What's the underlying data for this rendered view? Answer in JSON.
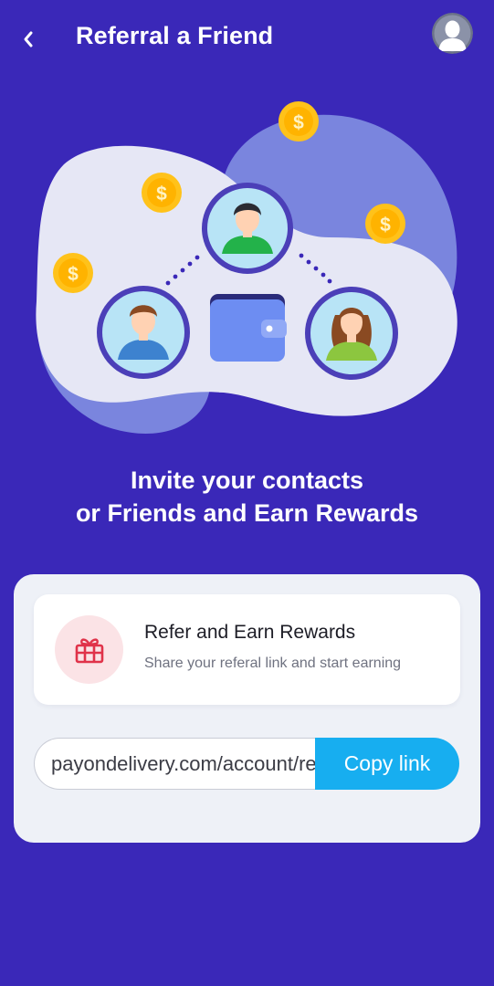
{
  "header": {
    "title": "Referral a Friend",
    "back_icon": "chevron-left-icon",
    "avatar_icon": "user-avatar-icon"
  },
  "hero": {
    "coin_symbol": "$",
    "colors": {
      "background": "#3a28b8",
      "blob_light": "#e6e7f5",
      "blob_accent": "#7a85de",
      "coin": "#ffc21a",
      "wallet": "#6d8df2"
    }
  },
  "headline": {
    "line1": "Invite your contacts",
    "line2": "or Friends and Earn Rewards"
  },
  "reward_card": {
    "icon": "gift-icon",
    "title": "Refer and Earn Rewards",
    "subtitle": "Share your referal link and start earning"
  },
  "referral": {
    "link_value": "payondelivery.com/account/referral",
    "copy_label": "Copy link"
  }
}
